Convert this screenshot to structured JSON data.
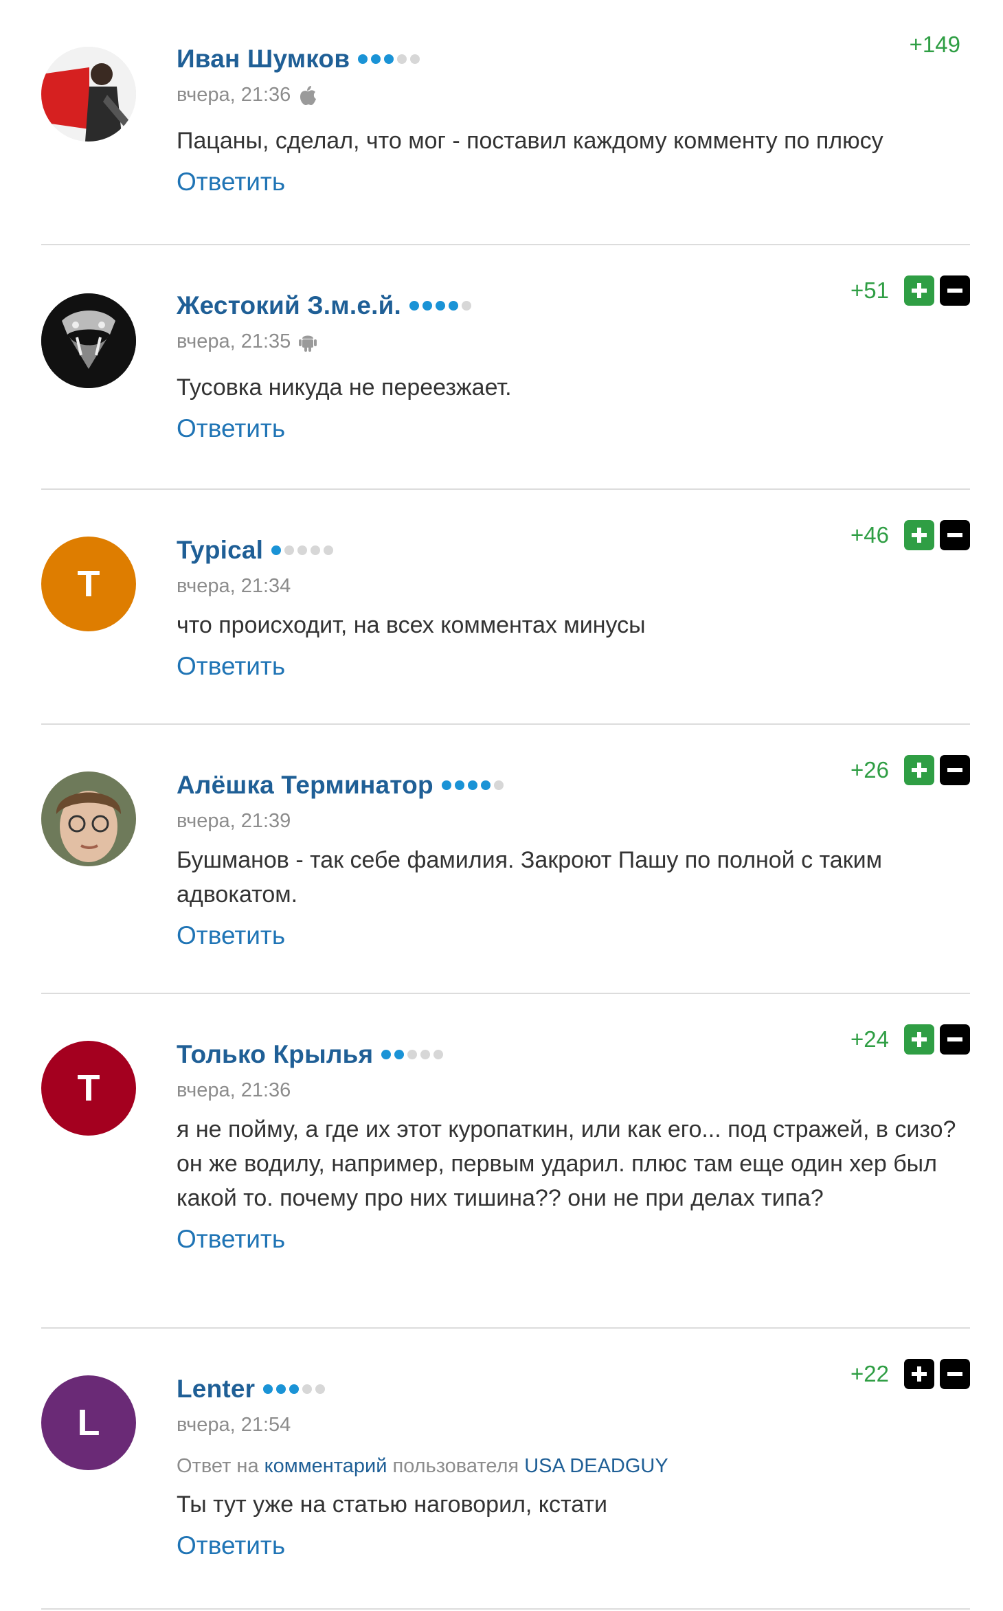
{
  "reply_label": "Ответить",
  "colors": {
    "author": "#1f5f96",
    "reply": "#1f74b5",
    "score": "#2f9e44",
    "vote_plus_active": "#2f9e44",
    "vote_neutral": "#000000",
    "dot_on": "#1a93d6",
    "dot_off": "#d7d7d7"
  },
  "comments": [
    {
      "author": "Иван Шумков",
      "rating_level": 3,
      "time": "вчера, 21:36",
      "platform_icon": "apple-icon",
      "avatar": {
        "type": "photo",
        "description_icon": "user-photo",
        "colors": [
          "#d62020",
          "#ffffff",
          "#333333"
        ]
      },
      "score": "+149",
      "votes": false,
      "text": "Пацаны, сделал, что мог - поставил каждому комменту по плюсу"
    },
    {
      "author": "Жестокий З.м.е.й.",
      "rating_level": 4,
      "time": "вчера, 21:35",
      "platform_icon": "android-icon",
      "avatar": {
        "type": "photo",
        "description_icon": "snake-photo",
        "colors": [
          "#111111",
          "#bbbbbb"
        ]
      },
      "score": "+51",
      "votes": true,
      "plus_active": true,
      "text": "Тусовка никуда не переезжает."
    },
    {
      "author": "Typical",
      "rating_level": 1,
      "time": "вчера, 21:34",
      "avatar": {
        "type": "letter",
        "letter": "T",
        "color": "#de7d00"
      },
      "score": "+46",
      "votes": true,
      "plus_active": true,
      "text": "что происходит, на всех комментах минусы"
    },
    {
      "author": "Алёшка Терминатор",
      "rating_level": 4,
      "time": "вчера, 21:39",
      "avatar": {
        "type": "photo",
        "description_icon": "face-photo",
        "colors": [
          "#7a5a3a",
          "#e0c0a8"
        ]
      },
      "score": "+26",
      "votes": true,
      "plus_active": true,
      "text": "Бушманов - так себе фамилия. Закроют Пашу по полной с таким адвокатом."
    },
    {
      "author": "Только Крылья",
      "rating_level": 2,
      "time": "вчера, 21:36",
      "avatar": {
        "type": "letter",
        "letter": "T",
        "color": "#a4001f"
      },
      "score": "+24",
      "votes": true,
      "plus_active": true,
      "text": "я не пойму, а где их этот куропаткин, или как его... под стражей, в сизо? он же водилу, например, первым ударил. плюс там еще один хер был какой то. почему про них тишина?? они не при делах типа?"
    },
    {
      "author": "Lenter",
      "rating_level": 3,
      "time": "вчера, 21:54",
      "avatar": {
        "type": "letter",
        "letter": "L",
        "color": "#6a2a76"
      },
      "score": "+22",
      "votes": true,
      "plus_active": false,
      "reply_to": {
        "prefix": "Ответ на",
        "link": "комментарий",
        "middle": "пользователя",
        "user": "USA DEADGUY"
      },
      "text": "Ты тут уже на статью наговорил, кстати"
    }
  ]
}
